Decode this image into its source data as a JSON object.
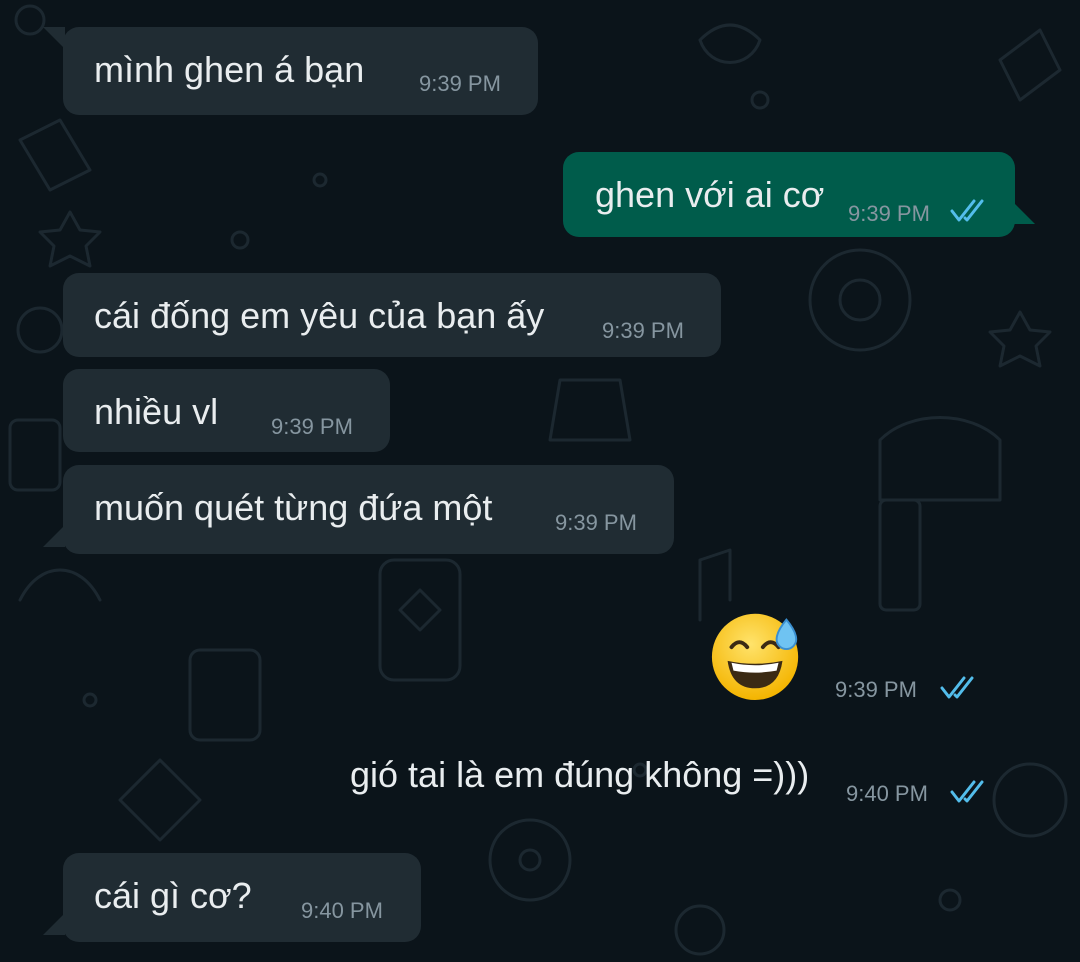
{
  "chat": {
    "messages": [
      {
        "text": "mình ghen á bạn",
        "time": "9:39 PM"
      },
      {
        "text": "ghen với ai cơ",
        "time": "9:39 PM"
      },
      {
        "text": "cái đống em yêu của bạn ấy",
        "time": "9:39 PM"
      },
      {
        "text": "nhiều vl",
        "time": "9:39 PM"
      },
      {
        "text": "muốn quét từng đứa một",
        "time": "9:39 PM"
      },
      {
        "text": "",
        "emoji": "grinning-face-with-sweat",
        "time": "9:39 PM"
      },
      {
        "text": "gió tai là em đúng không =)))",
        "time": "9:40 PM"
      },
      {
        "text": "cái gì cơ?",
        "time": "9:40 PM"
      }
    ]
  },
  "colors": {
    "background": "#0b141a",
    "incoming_bubble": "#202c33",
    "outgoing_bubble": "#005c4b",
    "read_receipt": "#53bdeb",
    "timestamp": "#8696a0"
  }
}
